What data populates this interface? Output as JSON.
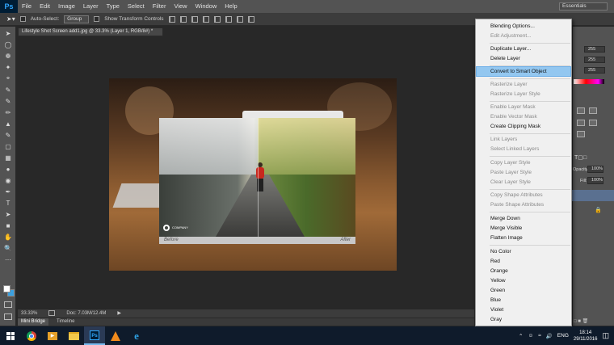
{
  "app": {
    "logo": "Ps",
    "menu": [
      "File",
      "Edit",
      "Image",
      "Layer",
      "Type",
      "Select",
      "Filter",
      "View",
      "Window",
      "Help"
    ]
  },
  "options_bar": {
    "auto_select_label": "Auto-Select:",
    "auto_select_value": "Group",
    "transform_label": "Show Transform Controls",
    "workspace": "Essentials"
  },
  "document": {
    "tab_title": "Lifestyle Shot Screen add1.jpg @ 33.3% (Layer 1, RGB/8#) *",
    "zoom": "33.33%",
    "doc_size": "Doc: 7.03M/12.4M",
    "screen_before": "Before",
    "screen_after": "After",
    "screen_brand": "COMPANY"
  },
  "bottom_tabs": [
    "Mini Bridge",
    "Timeline"
  ],
  "right_panel": {
    "rgb_values": [
      "255",
      "255",
      "255"
    ],
    "opacity_label": "Opacity:",
    "opacity_value": "100%",
    "fill_label": "Fill:",
    "fill_value": "100%"
  },
  "context_menu": {
    "items": [
      {
        "label": "Blending Options...",
        "enabled": true
      },
      {
        "label": "Edit Adjustment...",
        "enabled": false
      },
      {
        "label": "Duplicate Layer...",
        "enabled": true
      },
      {
        "label": "Delete Layer",
        "enabled": true
      },
      {
        "label": "Convert to Smart Object",
        "enabled": true,
        "highlighted": true
      },
      {
        "label": "Rasterize Layer",
        "enabled": false
      },
      {
        "label": "Rasterize Layer Style",
        "enabled": false
      },
      {
        "label": "Enable Layer Mask",
        "enabled": false
      },
      {
        "label": "Enable Vector Mask",
        "enabled": false
      },
      {
        "label": "Create Clipping Mask",
        "enabled": true
      },
      {
        "label": "Link Layers",
        "enabled": false
      },
      {
        "label": "Select Linked Layers",
        "enabled": false
      },
      {
        "label": "Copy Layer Style",
        "enabled": false
      },
      {
        "label": "Paste Layer Style",
        "enabled": false
      },
      {
        "label": "Clear Layer Style",
        "enabled": false
      },
      {
        "label": "Copy Shape Attributes",
        "enabled": false
      },
      {
        "label": "Paste Shape Attributes",
        "enabled": false
      },
      {
        "label": "Merge Down",
        "enabled": true
      },
      {
        "label": "Merge Visible",
        "enabled": true
      },
      {
        "label": "Flatten Image",
        "enabled": true
      },
      {
        "label": "No Color",
        "enabled": true
      },
      {
        "label": "Red",
        "enabled": true
      },
      {
        "label": "Orange",
        "enabled": true
      },
      {
        "label": "Yellow",
        "enabled": true
      },
      {
        "label": "Green",
        "enabled": true
      },
      {
        "label": "Blue",
        "enabled": true
      },
      {
        "label": "Violet",
        "enabled": true
      },
      {
        "label": "Gray",
        "enabled": true
      }
    ]
  },
  "taskbar": {
    "apps": [
      "start",
      "chrome",
      "media-player",
      "file-explorer",
      "photoshop",
      "vlc",
      "internet-explorer"
    ],
    "language": "ENG",
    "time": "18:14",
    "date": "29/11/2016"
  },
  "colors": {
    "highlight": "#93c7f0",
    "background_swatch": "#3aa0e0",
    "ps_blue": "#31a8ff"
  }
}
